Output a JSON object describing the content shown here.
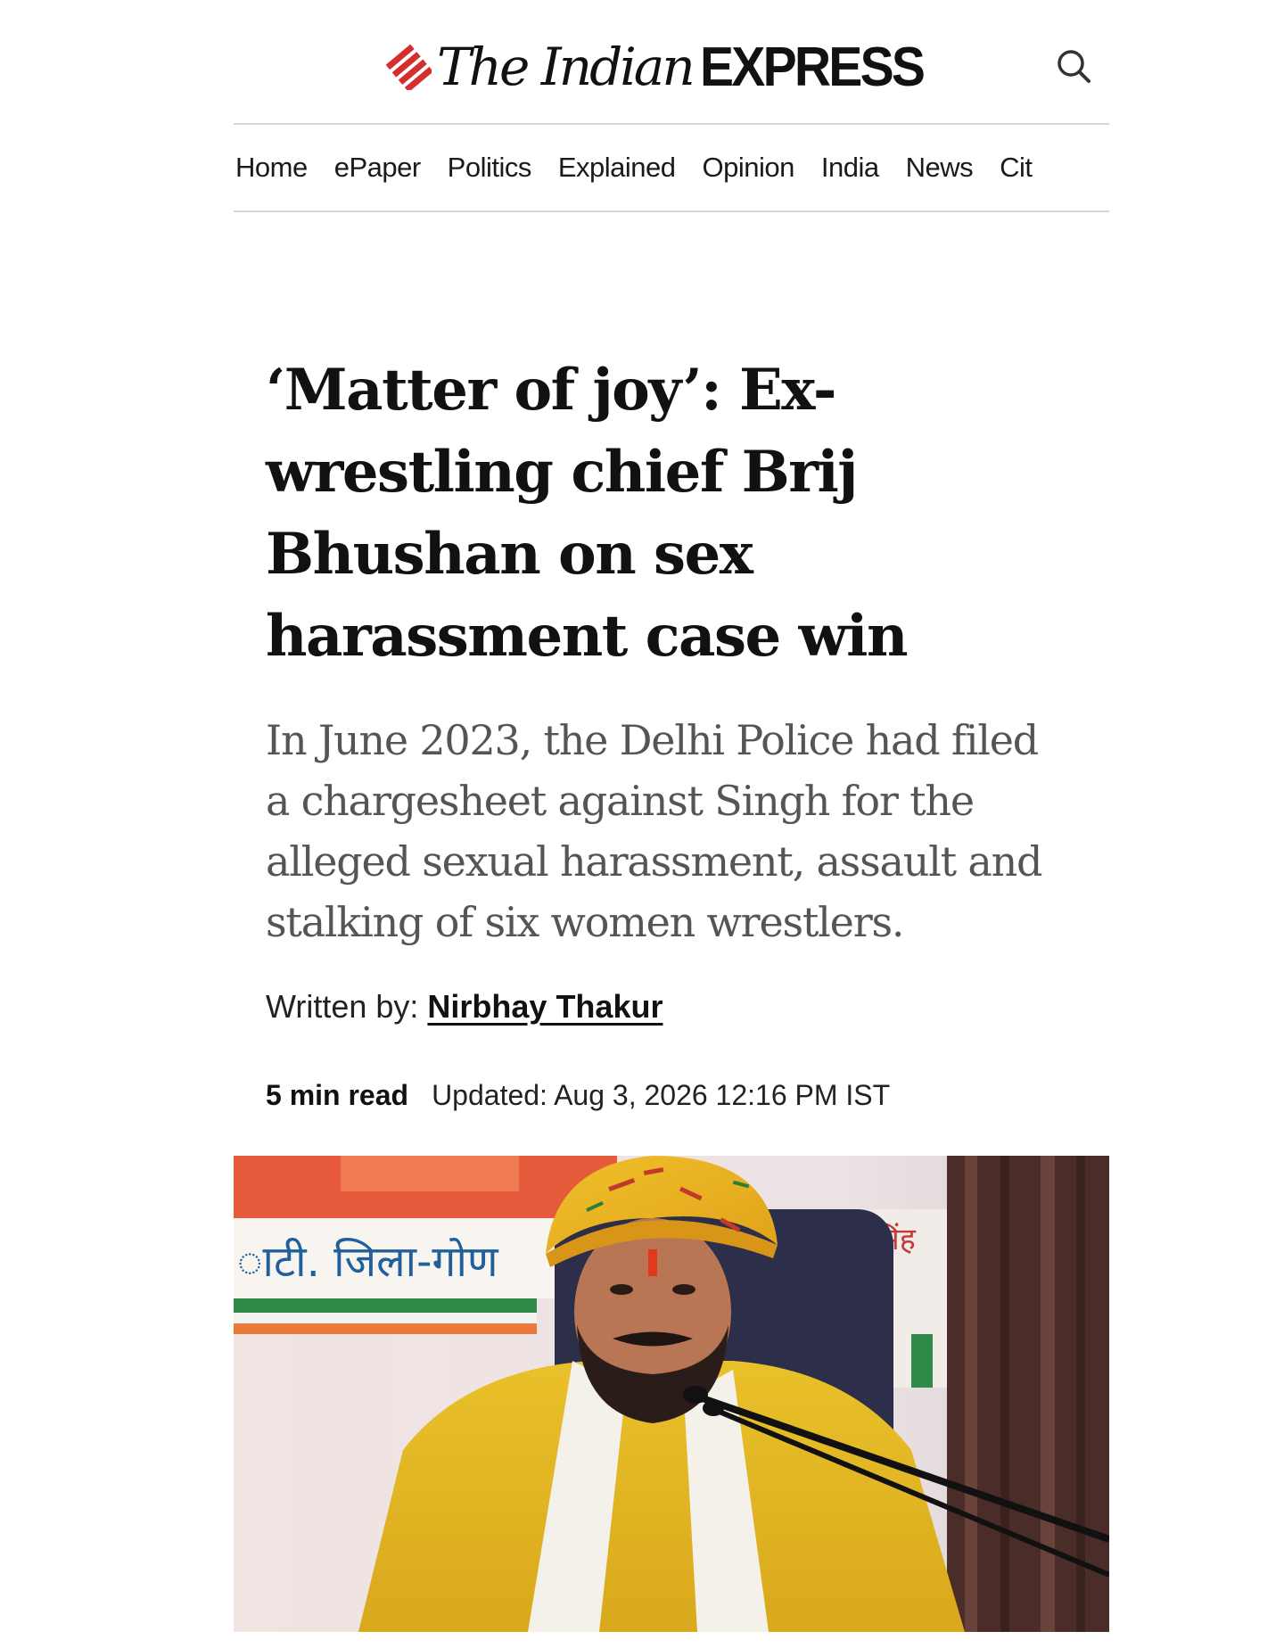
{
  "header": {
    "brand_part1": "The Indian",
    "brand_part2": "EXPRESS",
    "brand_colors": {
      "mark": "#d42e2e",
      "text": "#111111"
    },
    "search_icon": "search-icon"
  },
  "nav": {
    "items": [
      "Home",
      "ePaper",
      "Politics",
      "Explained",
      "Opinion",
      "India",
      "News",
      "Cit"
    ]
  },
  "article": {
    "headline": "‘Matter of joy’: Ex-wrestling chief Brij Bhushan on sex harassment case win",
    "standfirst": "In June 2023, the Delhi Police had filed a chargesheet against Singh for the alleged sexual harassment, assault and stalking of six women wrestlers.",
    "byline_prefix": "Written by:",
    "author": "Nirbhay Thakur",
    "read_time": "5 min read",
    "updated": "Updated: Aug 3, 2026 12:16 PM IST"
  },
  "hero_image": {
    "banner_text_left": "ाटी. जिला-गोण",
    "banner_text_right": "सिंह"
  }
}
